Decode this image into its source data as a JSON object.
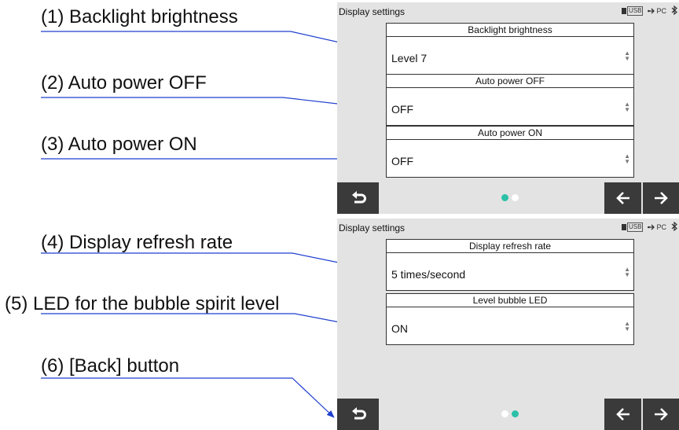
{
  "callouts": [
    "(1) Backlight brightness",
    "(2) Auto power OFF",
    "(3) Auto power ON",
    "(4) Display refresh rate",
    "(5) LED for the bubble spirit level",
    "(6) [Back] button"
  ],
  "screens": [
    {
      "title": "Display settings",
      "status": {
        "usb_label": "USB",
        "pc_label": "PC",
        "icons": [
          "usb-icon",
          "pc-connection-icon",
          "bluetooth-icon"
        ]
      },
      "settings": [
        {
          "label": "Backlight brightness",
          "value": "Level 7"
        },
        {
          "label": "Auto power OFF",
          "value": "OFF"
        },
        {
          "label": "Auto power ON",
          "value": "OFF"
        }
      ],
      "pagination": {
        "pages": 2,
        "active": 1
      }
    },
    {
      "title": "Display settings",
      "status": {
        "usb_label": "USB",
        "pc_label": "PC",
        "icons": [
          "usb-icon",
          "pc-connection-icon",
          "bluetooth-icon"
        ]
      },
      "settings": [
        {
          "label": "Display refresh rate",
          "value": "5 times/second"
        },
        {
          "label": "Level bubble LED",
          "value": "ON"
        }
      ],
      "pagination": {
        "pages": 2,
        "active": 2
      }
    }
  ],
  "nav_icons": {
    "back": "return-arrow-icon",
    "prev": "arrow-left-icon",
    "next": "arrow-right-icon"
  },
  "colors": {
    "callout_line": "#1f3fcf",
    "screen_bg": "#e3e3e3",
    "nav_button": "#3a3a3a",
    "dot_active": "#2cc0a8",
    "dot_inactive": "#ffffff"
  }
}
